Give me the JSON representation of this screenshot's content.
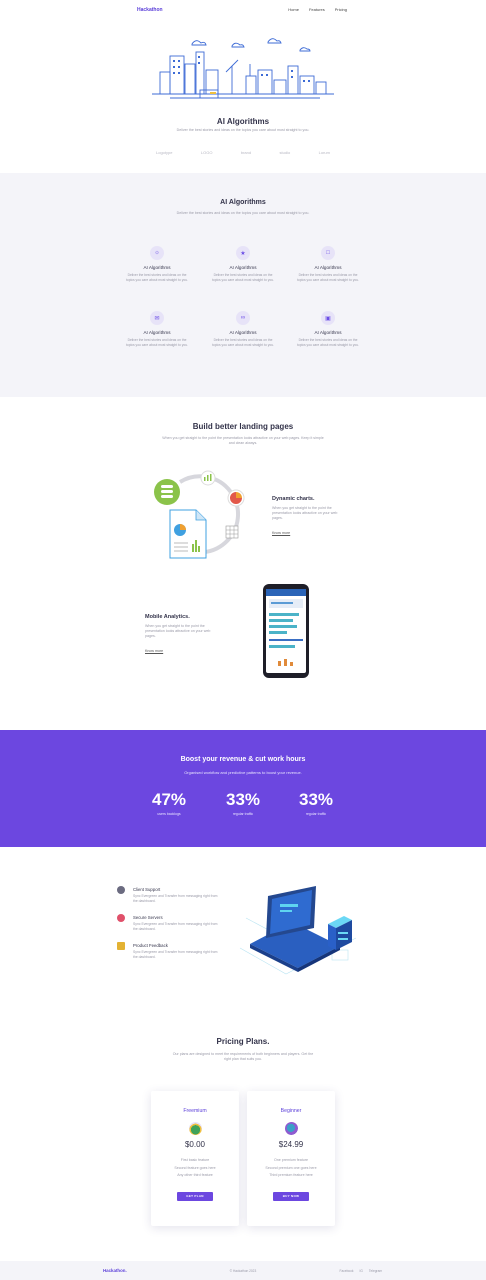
{
  "header": {
    "brand": "Hackathon",
    "nav": [
      "Home",
      "Features",
      "Pricing"
    ]
  },
  "hero": {
    "title": "AI Algorithms",
    "subtitle": "Deliver the best stories and ideas on the topics you care about most straight to you.",
    "logos": [
      "Logotype",
      "LOGO",
      "brand",
      "studio",
      "Lorum"
    ]
  },
  "features": {
    "title": "AI Algorithms",
    "subtitle": "Deliver the best stories and ideas on the topics you care about most straight to you.",
    "items": [
      {
        "icon": "bell-icon",
        "glyph": "🔔",
        "title": "AI Algorithms",
        "text": "Deliver the best stories and ideas on the topics you care about most straight to you."
      },
      {
        "icon": "trophy-icon",
        "glyph": "🏆",
        "title": "AI Algorithms",
        "text": "Deliver the best stories and ideas on the topics you care about most straight to you."
      },
      {
        "icon": "document-icon",
        "glyph": "📄",
        "title": "AI Algorithms",
        "text": "Deliver the best stories and ideas on the topics you care about most straight to you."
      },
      {
        "icon": "mail-icon",
        "glyph": "✉",
        "title": "AI Algorithms",
        "text": "Deliver the best stories and ideas on the topics you care about most straight to you."
      },
      {
        "icon": "link-icon",
        "glyph": "🔗",
        "title": "AI Algorithms",
        "text": "Deliver the best stories and ideas on the topics you care about most straight to you."
      },
      {
        "icon": "image-icon",
        "glyph": "🖼",
        "title": "AI Algorithms",
        "text": "Deliver the best stories and ideas on the topics you care about most straight to you."
      }
    ]
  },
  "landing": {
    "title": "Build better landing pages",
    "subtitle": "When you get straight to the point the presentation looks attractive on your web pages. Keep it simple and clean always.",
    "blocks": [
      {
        "title": "Dynamic charts.",
        "text": "When you get straight to the point the presentation looks attractive on your web pages.",
        "link": "Know more"
      },
      {
        "title": "Mobile Analytics.",
        "text": "When you get straight to the point the presentation looks attractive on your web pages.",
        "link": "Know more"
      }
    ]
  },
  "stats": {
    "title": "Boost your revenue & cut work hours",
    "subtitle": "Organised workflow and predictive patterns to boost your revenue.",
    "items": [
      {
        "value": "47%",
        "label": "users backlogs"
      },
      {
        "value": "33%",
        "label": "regular traffic"
      },
      {
        "value": "33%",
        "label": "regular traffic"
      }
    ]
  },
  "services": [
    {
      "icon": "support-icon",
      "color": "#6b6b80",
      "title": "Client Support",
      "text": "Sync Evergreen and Transfer from messaging right from the dashboard."
    },
    {
      "icon": "server-icon",
      "color": "#e0506a",
      "title": "Secure Servers",
      "text": "Sync Evergreen and Transfer from messaging right from the dashboard."
    },
    {
      "icon": "feedback-icon",
      "color": "#e3b233",
      "title": "Product Feedback",
      "text": "Sync Evergreen and Transfer from messaging right from the dashboard."
    }
  ],
  "pricing": {
    "title": "Pricing Plans.",
    "subtitle": "Our plans are designed to meet the requirements of both beginners and players. Get the right plan that suits you.",
    "plans": [
      {
        "name": "Freemium",
        "price": "$0.00",
        "features": [
          "First basic feature",
          "Second feature goes here",
          "Any other third feature"
        ],
        "button": "GET PLAN",
        "color": "#3fa35a"
      },
      {
        "name": "Beginner",
        "price": "$24.99",
        "features": [
          "One premium feature",
          "Second premium one goes here",
          "Third premium feature here"
        ],
        "button": "BUY NOW",
        "color": "#3aa0c8"
      }
    ]
  },
  "footer": {
    "brand": "Hackathon.",
    "copyright": "© Hackathon 2023",
    "links": [
      "Facebook",
      "IG",
      "Telegram"
    ]
  }
}
